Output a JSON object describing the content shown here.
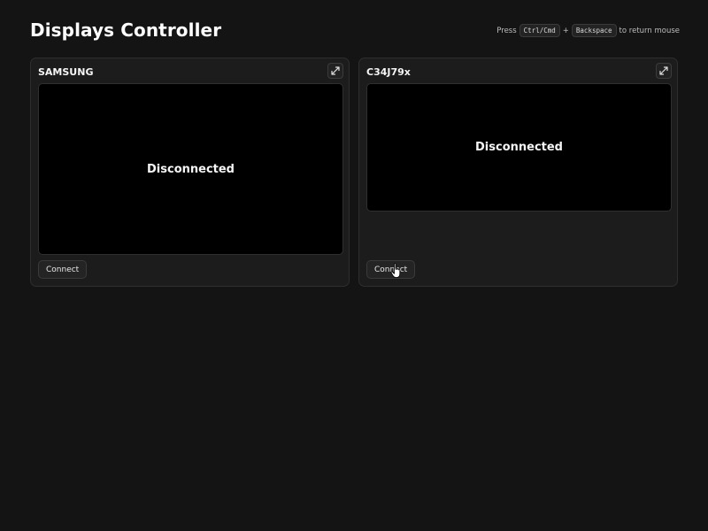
{
  "page": {
    "title": "Displays Controller",
    "hint": {
      "press": "Press",
      "key1": "Ctrl/Cmd",
      "plus": "+",
      "key2": "Backspace",
      "suffix": "to return mouse"
    }
  },
  "displays": [
    {
      "name": "SAMSUNG",
      "status": "Disconnected",
      "connect_label": "Connect",
      "expand_icon": "expand-icon"
    },
    {
      "name": "C34J79x",
      "status": "Disconnected",
      "connect_label": "Connect",
      "expand_icon": "expand-icon"
    }
  ],
  "cursor_icon": "hand-pointer-icon",
  "colors": {
    "background": "#141414",
    "panel": "#1c1c1c",
    "screen": "#000000",
    "text": "#f2f2f2"
  }
}
